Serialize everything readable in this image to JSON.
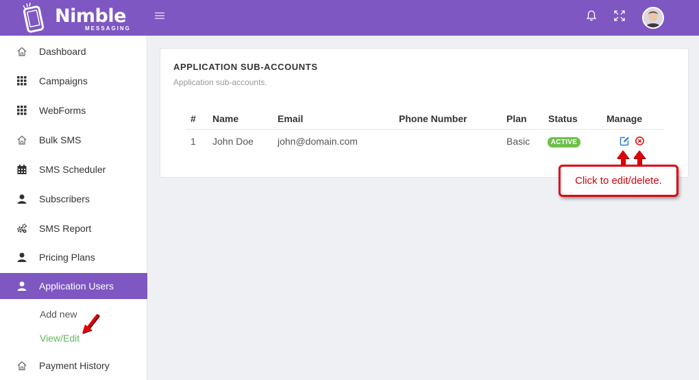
{
  "brand": {
    "name": "Nimble",
    "tagline": "MESSAGING"
  },
  "header": {
    "menu_icon": "hamburger-icon",
    "icons": [
      "bell-icon",
      "fullscreen-icon"
    ],
    "avatar": "user-avatar"
  },
  "sidebar": {
    "items": [
      {
        "label": "Dashboard",
        "icon": "home-icon"
      },
      {
        "label": "Campaigns",
        "icon": "grid-icon"
      },
      {
        "label": "WebForms",
        "icon": "grid-icon"
      },
      {
        "label": "Bulk SMS",
        "icon": "home-icon"
      },
      {
        "label": "SMS Scheduler",
        "icon": "calendar-icon"
      },
      {
        "label": "Subscribers",
        "icon": "user-icon"
      },
      {
        "label": "SMS Report",
        "icon": "gears-icon"
      },
      {
        "label": "Pricing Plans",
        "icon": "user-icon"
      },
      {
        "label": "Application Users",
        "icon": "user-icon"
      },
      {
        "label": "Payment History",
        "icon": "home-icon"
      }
    ],
    "active_index": 8,
    "subitems": [
      {
        "label": "Add new"
      },
      {
        "label": "View/Edit"
      }
    ]
  },
  "card": {
    "title": "APPLICATION SUB-ACCOUNTS",
    "subtitle": "Application sub-accounts."
  },
  "table": {
    "headers": [
      "#",
      "Name",
      "Email",
      "Phone Number",
      "Plan",
      "Status",
      "Manage"
    ],
    "rows": [
      {
        "num": "1",
        "name": "John Doe",
        "email": "john@domain.com",
        "phone": "",
        "plan": "Basic",
        "status": "ACTIVE"
      }
    ]
  },
  "callout": {
    "text": "Click to edit/delete."
  },
  "colors": {
    "brand": "#7e57c2",
    "active_badge": "#6cc04a",
    "link_green": "#5cb85c",
    "callout_red": "#e0000b"
  }
}
